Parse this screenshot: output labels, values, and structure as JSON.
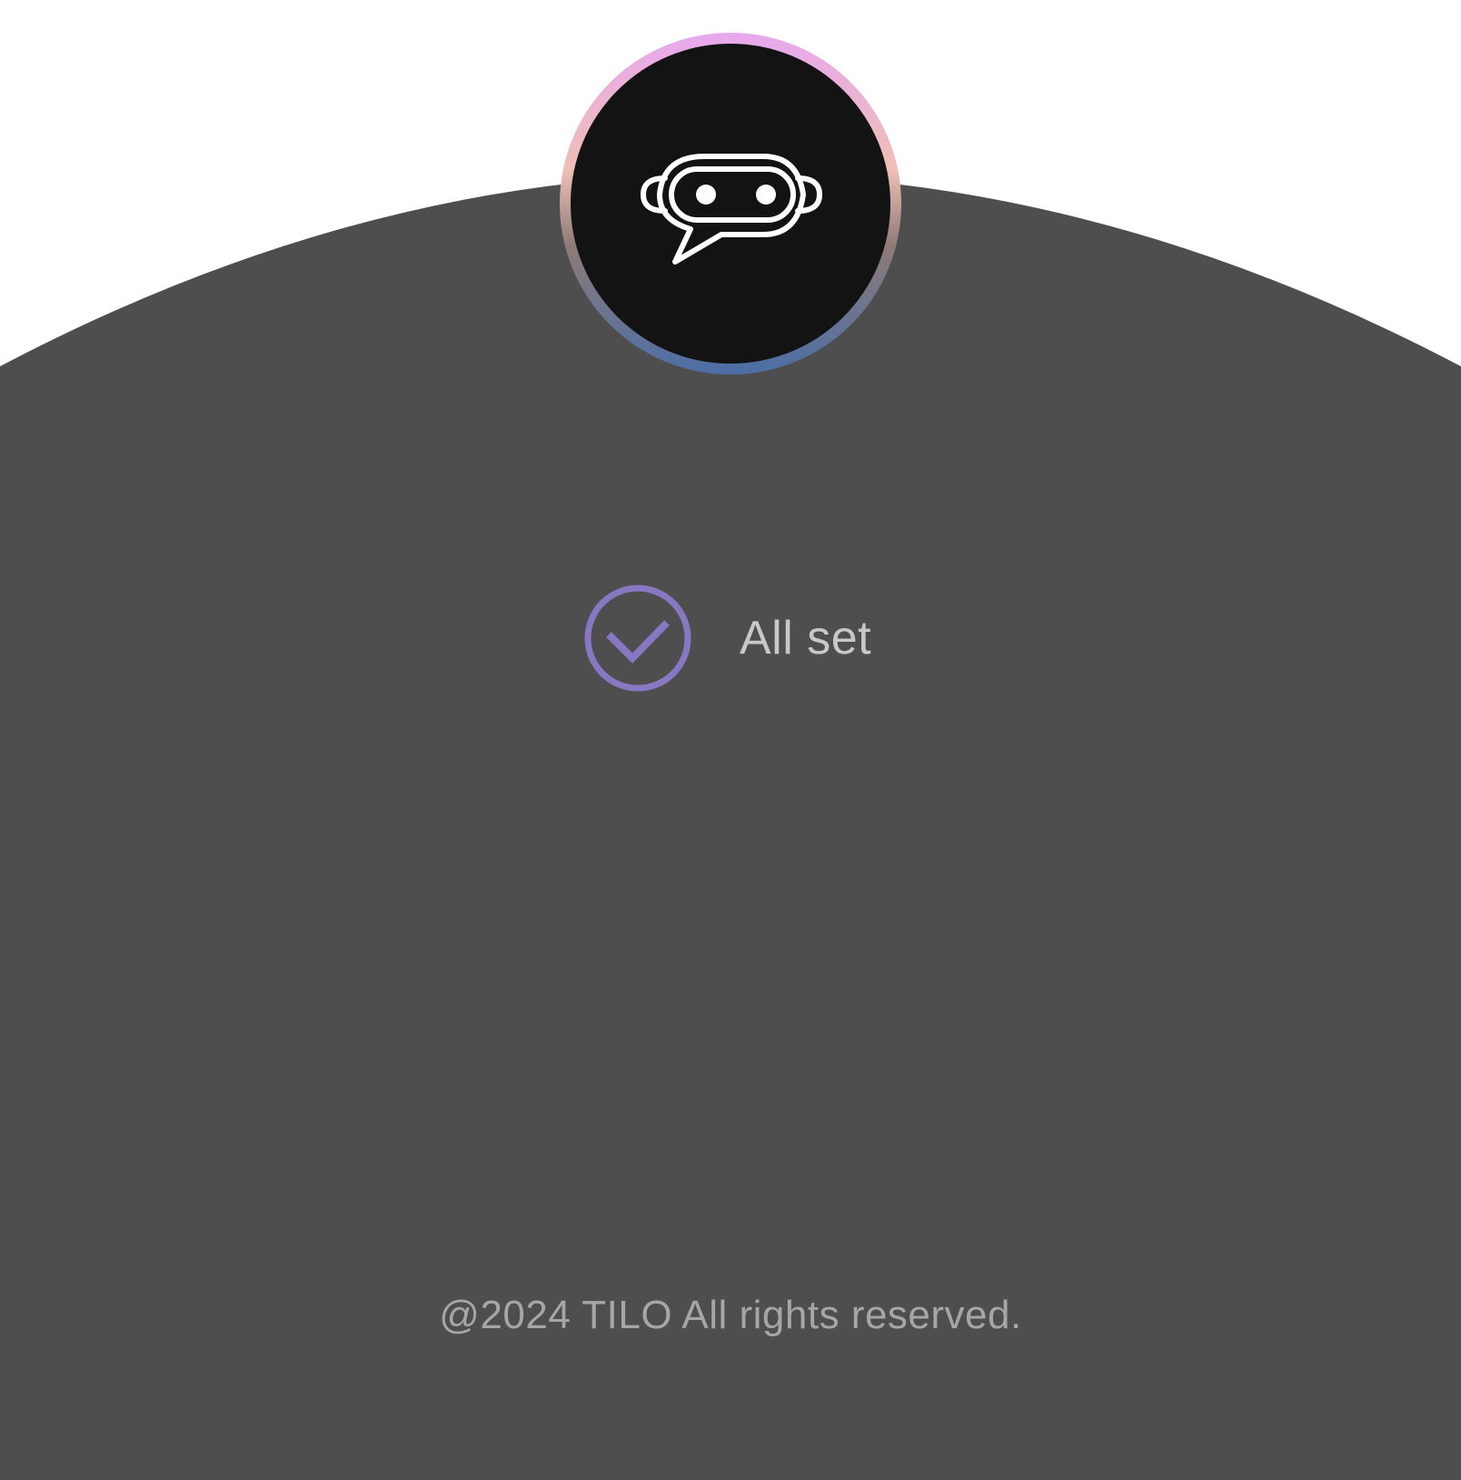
{
  "screen": {
    "background": "#ffffff",
    "panel_color": "#4e4e4e"
  },
  "avatar": {
    "icon": "chat-robot-icon",
    "ring_colors": [
      "#e8a8ee",
      "#efbfb6",
      "#4c6ea6"
    ],
    "core_color": "#131313"
  },
  "status": {
    "icon": "check-circle-icon",
    "icon_color": "#8878c3",
    "text": "All set"
  },
  "footer": {
    "text": "@2024 TILO All rights reserved."
  }
}
